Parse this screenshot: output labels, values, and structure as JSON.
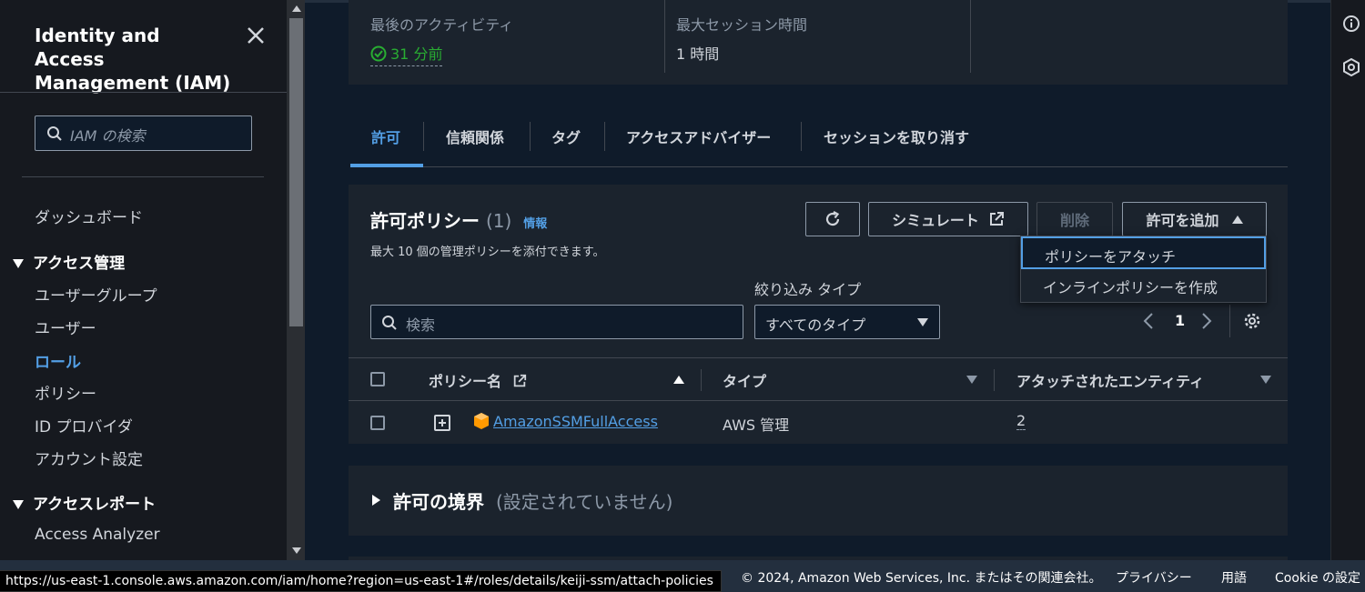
{
  "sidebar": {
    "title": "Identity and Access Management (IAM)",
    "search_placeholder": "IAM の検索",
    "dashboard": "ダッシュボード",
    "section_access": "アクセス管理",
    "items": [
      "ユーザーグループ",
      "ユーザー",
      "ロール",
      "ポリシー",
      "ID プロバイダ",
      "アカウント設定"
    ],
    "active_item": "ロール",
    "section_reports": "アクセスレポート",
    "report_items": [
      "Access Analyzer"
    ]
  },
  "summary": {
    "last_activity_label": "最後のアクティビティ",
    "last_activity_value": "31 分前",
    "max_session_label": "最大セッション時間",
    "max_session_value": "1 時間"
  },
  "tabs": [
    {
      "label": "許可",
      "active": true
    },
    {
      "label": "信頼関係"
    },
    {
      "label": "タグ"
    },
    {
      "label": "アクセスアドバイザー"
    },
    {
      "label": "セッションを取り消す"
    }
  ],
  "permissions": {
    "title": "許可ポリシー",
    "count": "(1)",
    "info": "情報",
    "description": "最大 10 個の管理ポリシーを添付できます。",
    "simulate_label": "シミュレート",
    "delete_label": "削除",
    "add_label": "許可を追加",
    "filter_label": "絞り込み タイプ",
    "search_placeholder": "検索",
    "filter_value": "すべてのタイプ",
    "page": "1",
    "columns": [
      "ポリシー名",
      "タイプ",
      "アタッチされたエンティティ"
    ],
    "rows": [
      {
        "name": "AmazonSSMFullAccess",
        "type": "AWS 管理",
        "entities": "2"
      }
    ],
    "menu": [
      "ポリシーをアタッチ",
      "インラインポリシーを作成"
    ]
  },
  "boundary": {
    "title": "許可の境界",
    "subtitle": "(設定されていません)"
  },
  "status_url": "https://us-east-1.console.aws.amazon.com/iam/home?region=us-east-1#/roles/details/keiji-ssm/attach-policies",
  "footer": {
    "copyright": "© 2024, Amazon Web Services, Inc. またはその関連会社。",
    "privacy": "プライバシー",
    "terms": "用語",
    "cookie": "Cookie の設定"
  },
  "colors": {
    "accent": "#539fe5",
    "success": "#29ad32",
    "background": "#0f1b2a",
    "panel": "#1b232d"
  }
}
